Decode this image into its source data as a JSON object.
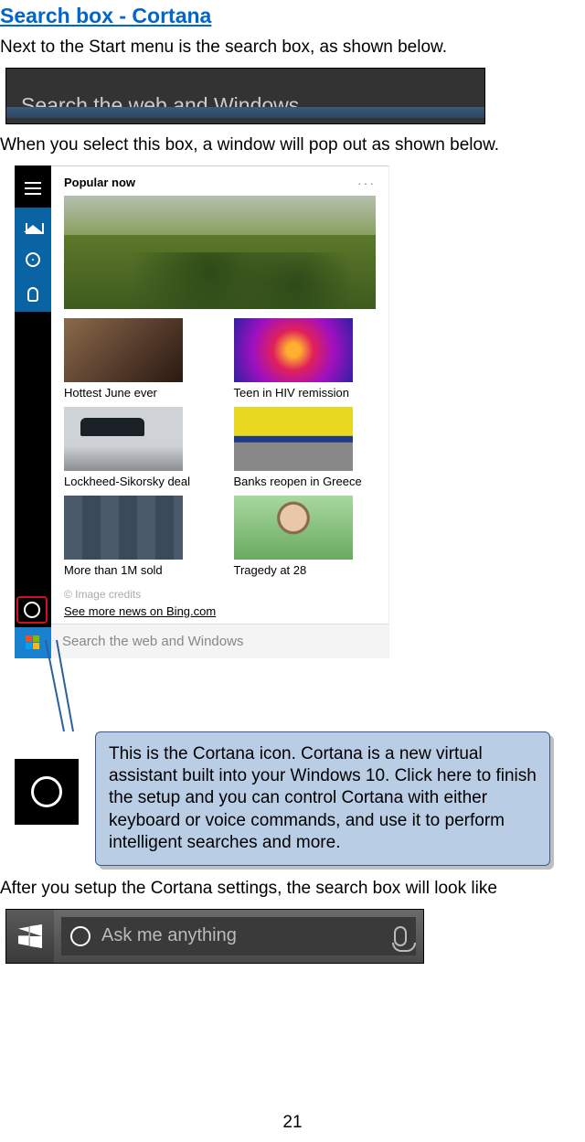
{
  "heading": "Search box - Cortana",
  "intro1": "Next to the Start menu is the search box, as shown below.",
  "searchbox1_placeholder": "Search the web and Windows",
  "intro2": "When you select this box, a window will pop out as shown below.",
  "popup": {
    "popular_now": "Popular now",
    "more_icon": "···",
    "news": [
      {
        "label": "Hottest June ever"
      },
      {
        "label": "Teen in HIV remission"
      },
      {
        "label": "Lockheed-Sikorsky deal"
      },
      {
        "label": "Banks reopen in Greece"
      },
      {
        "label": "More than 1M sold"
      },
      {
        "label": "Tragedy at 28"
      }
    ],
    "image_credits": "© Image credits",
    "bing_link": "See more news on Bing.com",
    "search_placeholder": "Search the web and Windows"
  },
  "callout": "This is the Cortana icon. Cortana is a new virtual assistant built into your Windows 10. Click here to finish the setup and you can control Cortana with either keyboard or voice commands, and use it to perform intelligent searches and more.",
  "after_text": "After you setup the Cortana settings, the search box will look like",
  "searchbox2_placeholder": "Ask me anything",
  "page_number": "21"
}
